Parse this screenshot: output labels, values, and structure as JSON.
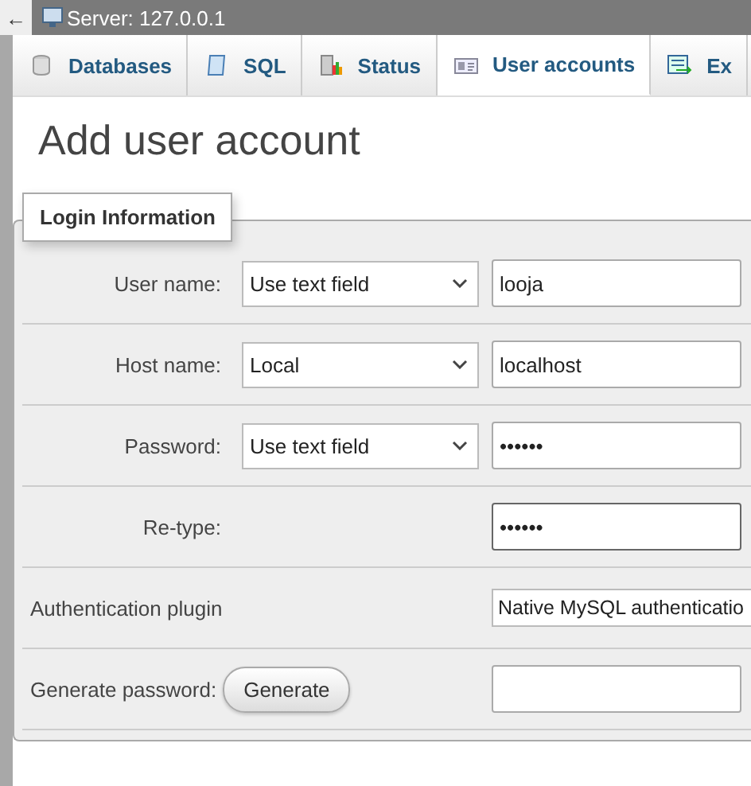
{
  "top_bar": {
    "back": "←",
    "server": "Server: 127.0.0.1"
  },
  "tabs": [
    {
      "label": "Databases",
      "selected": false
    },
    {
      "label": "SQL",
      "selected": false
    },
    {
      "label": "Status",
      "selected": false
    },
    {
      "label": "User accounts",
      "selected": true
    },
    {
      "label": "Ex",
      "selected": false
    }
  ],
  "title": "Add user account",
  "legend": "Login Information",
  "rows": [
    {
      "kind": "select_input",
      "label": "User name:",
      "select": "Use text field",
      "value": "looja",
      "focused": false
    },
    {
      "kind": "select_input",
      "label": "Host name:",
      "select": "Local",
      "value": "localhost",
      "focused": false
    },
    {
      "kind": "select_input",
      "label": "Password:",
      "select": "Use text field",
      "value": "••••••",
      "focused": false
    },
    {
      "kind": "input",
      "label": "Re-type:",
      "value": "••••••",
      "focused": true
    },
    {
      "kind": "plugin",
      "label": "Authentication plugin",
      "value": "Native MySQL authenticatio"
    },
    {
      "kind": "generate",
      "label": "Generate password:",
      "button": "Generate"
    }
  ]
}
